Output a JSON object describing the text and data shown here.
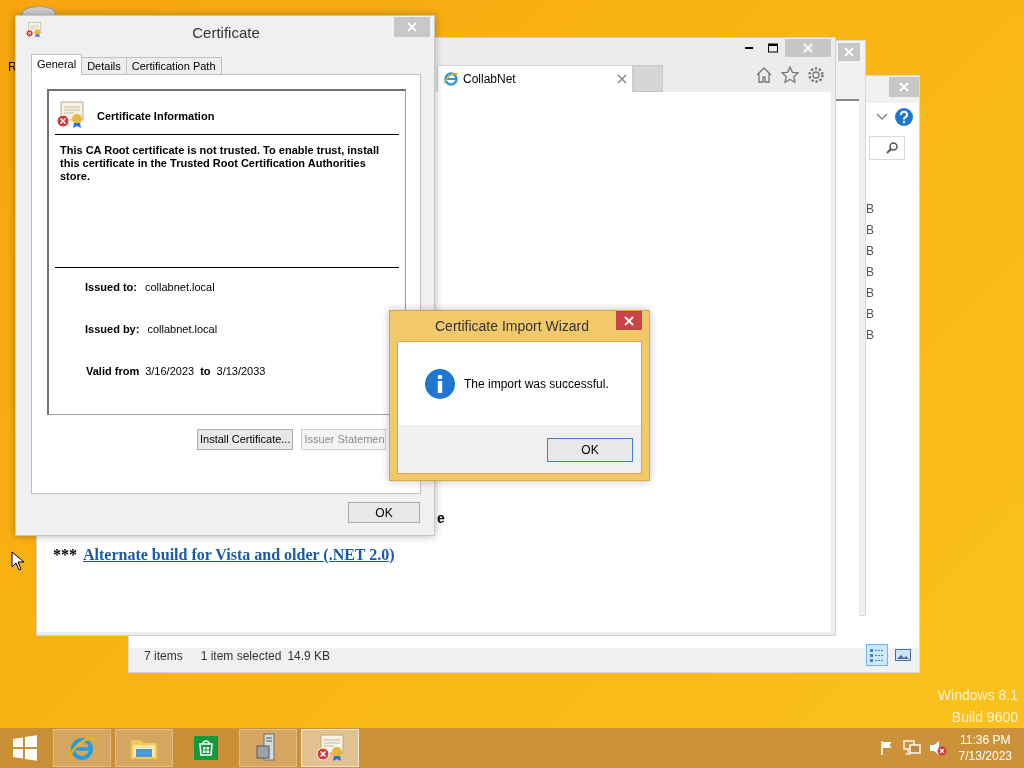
{
  "desktop": {
    "icon_label": "R",
    "watermark": [
      "Windows 8.1",
      "Build 9600"
    ]
  },
  "explorer_window": {
    "size_column": [
      "B",
      "B",
      "B",
      "B",
      "B",
      "B",
      "B"
    ],
    "status_bar": {
      "item_count": "7 items",
      "selection": "1 item selected",
      "size": "14.9 KB"
    },
    "view_buttons": [
      {
        "kind": "details",
        "selected": true
      },
      {
        "kind": "large-icons",
        "selected": false
      }
    ]
  },
  "browser_window": {
    "tabs": [
      {
        "title": "CollabNet"
      }
    ],
    "page": {
      "cut_text": "e",
      "prefix": "***",
      "link": "Alternate build for Vista and older (.NET 2.0)"
    }
  },
  "certificate_dialog": {
    "title": "Certificate",
    "tabs": [
      {
        "label": "General",
        "selected": true
      },
      {
        "label": "Details",
        "selected": false
      },
      {
        "label": "Certification Path",
        "selected": false
      }
    ],
    "heading": "Certificate Information",
    "message": "This CA Root certificate is not trusted. To enable trust, install this certificate in the Trusted Root Certification Authorities store.",
    "fields": [
      {
        "label": "Issued to:",
        "value": "collabnet.local"
      },
      {
        "label": "Issued by:",
        "value": "collabnet.local"
      }
    ],
    "validity": {
      "label": "Valid from",
      "from": "3/16/2023",
      "to_label": "to",
      "to": "3/13/2033"
    },
    "buttons": [
      {
        "label": "Install Certificate...",
        "disabled": false
      },
      {
        "label": "Issuer Statemen",
        "disabled": true
      }
    ],
    "ok": "OK"
  },
  "wizard_dialog": {
    "title": "Certificate Import Wizard",
    "message": "The import was successful.",
    "ok": "OK"
  },
  "taskbar": {
    "apps": [
      {
        "kind": "ie",
        "running": true,
        "active": false
      },
      {
        "kind": "explorer",
        "running": true,
        "active": false
      },
      {
        "kind": "store",
        "running": false,
        "active": false
      },
      {
        "kind": "server",
        "running": true,
        "active": false
      },
      {
        "kind": "certificate",
        "running": true,
        "active": true
      }
    ],
    "clock": {
      "time": "11:36 PM",
      "date": "7/13/2023"
    }
  }
}
